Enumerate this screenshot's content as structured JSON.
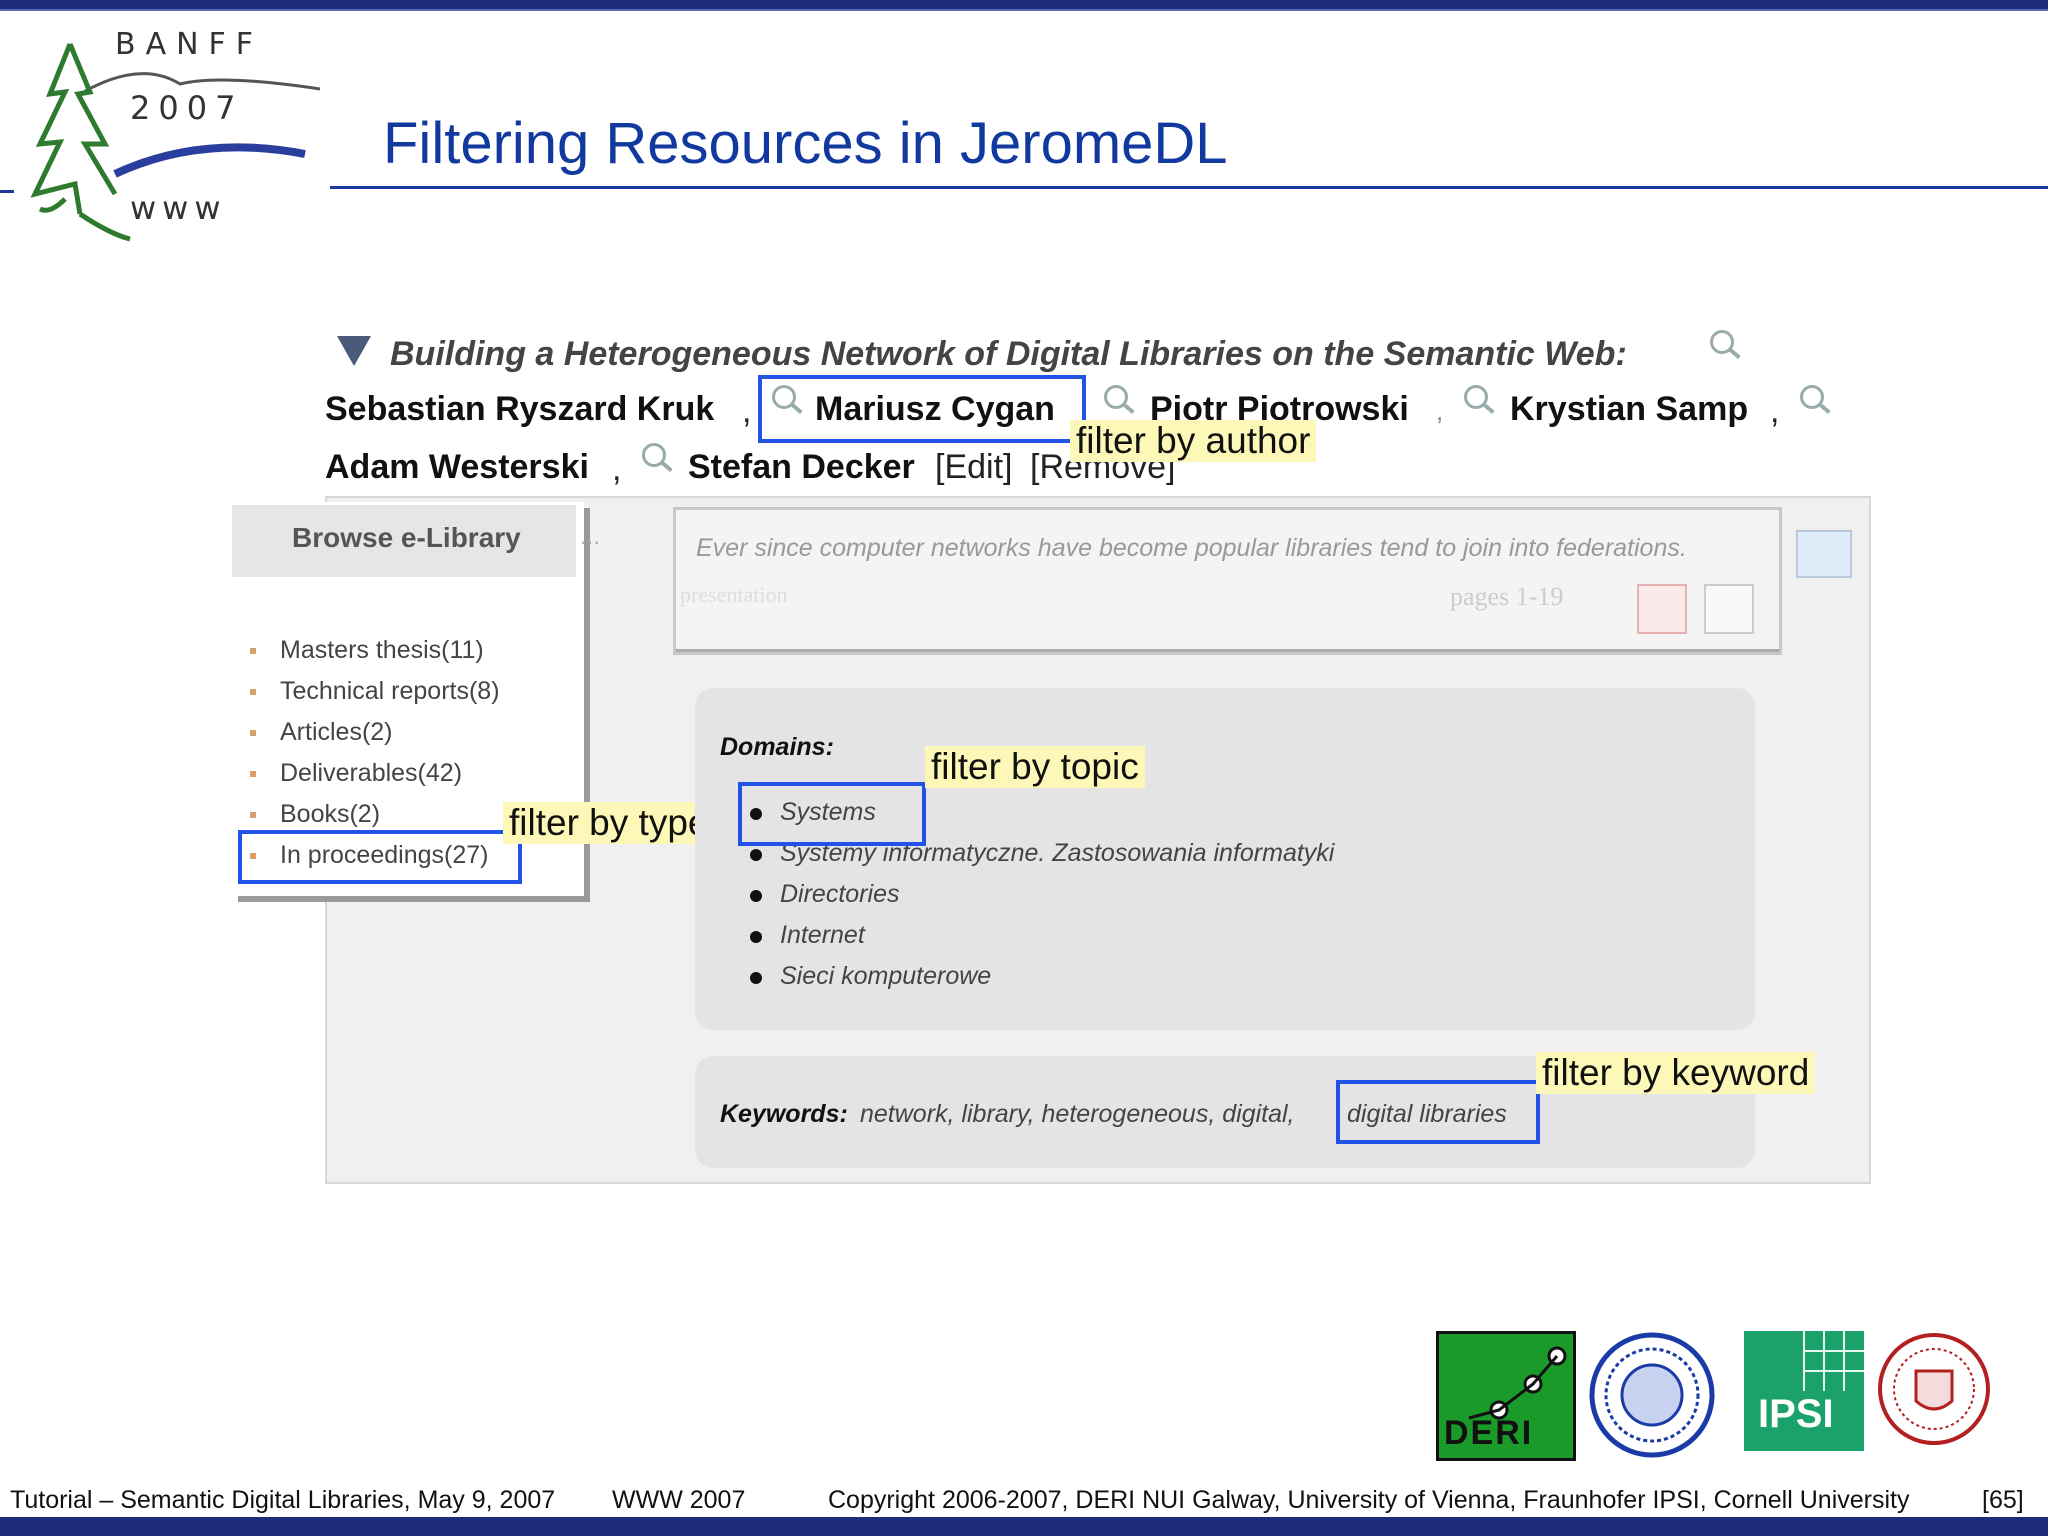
{
  "slide": {
    "title": "Filtering Resources in JeromeDL",
    "logo": {
      "line1": "BANFF",
      "line2": "2007",
      "line3": "www"
    }
  },
  "resource": {
    "title": "Building a Heterogeneous Network of Digital Libraries on the Semantic Web:",
    "authors": [
      "Sebastian Ryszard Kruk",
      "Mariusz Cygan",
      "Piotr Piotrowski",
      "Krystian Samp",
      "Adam Westerski",
      "Stefan Decker"
    ],
    "edit_label": "[Edit]",
    "remove_label": "[Remove]",
    "abstract": "Ever since computer networks have become popular libraries tend to join into federations.",
    "pages": "pages 1-19",
    "presentation": "presentation"
  },
  "sidebar": {
    "title": "Browse e-Library",
    "categories": [
      "Masters thesis(11)",
      "Technical reports(8)",
      "Articles(2)",
      "Deliverables(42)",
      "Books(2)",
      "In proceedings(27)"
    ]
  },
  "domains": {
    "label": "Domains:",
    "items": [
      "Systems",
      "Systemy informatyczne. Zastosowania informatyki",
      "Directories",
      "Internet",
      "Sieci komputerowe"
    ]
  },
  "keywords": {
    "label": "Keywords:",
    "values": "network, library, heterogeneous, digital,",
    "highlighted": "digital libraries"
  },
  "callouts": {
    "author": "filter by author",
    "type": "filter by type",
    "topic": "filter by topic",
    "keyword": "filter by keyword"
  },
  "footer": {
    "left": "Tutorial – Semantic Digital Libraries, May 9, 2007",
    "mid": "WWW 2007",
    "copyright": "Copyright 2006-2007, DERI NUI Galway, University of Vienna, Fraunhofer IPSI, Cornell University",
    "page": "[65]"
  },
  "partner_logos": {
    "deri": "DERI",
    "ipsi": "IPSI"
  },
  "colors": {
    "title": "#12399f",
    "highlight_border": "#2352e6",
    "callout_bg": "#fdf8b8",
    "bar": "#1f2a7a"
  }
}
